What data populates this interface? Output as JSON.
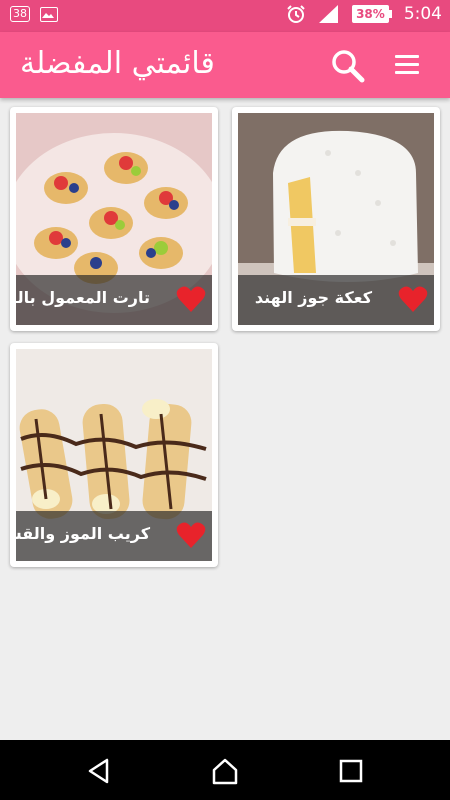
{
  "status": {
    "notif_count": "38",
    "battery": "38%",
    "time": "5:04"
  },
  "app": {
    "title": "قائمتي المفضلة",
    "search_icon": "search-icon",
    "menu_icon": "menu-icon"
  },
  "colors": {
    "appbar": "#fa5b8e",
    "statusbar": "#e84a7f",
    "heart": "#e8232b"
  },
  "favorites": [
    {
      "name": "كعكة جوز الهند",
      "favorite": true
    },
    {
      "name": "تارت المعمول بالقشطة",
      "favorite": true
    },
    {
      "name": "كريب الموز والقشطة",
      "favorite": true
    }
  ],
  "nav": {
    "back_icon": "back-icon",
    "home_icon": "home-icon",
    "recents_icon": "recents-icon"
  }
}
